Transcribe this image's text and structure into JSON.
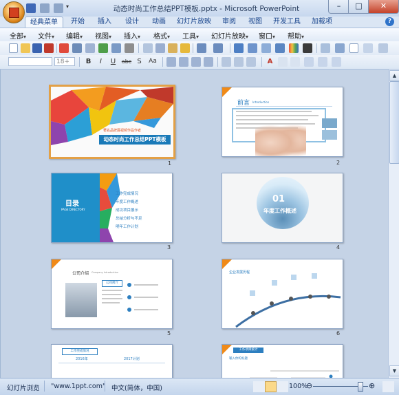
{
  "window": {
    "title": "动态时尚工作总结PPT模板.pptx - Microsoft PowerPoint",
    "minimize_glyph": "–",
    "maximize_glyph": "□",
    "close_glyph": "✕"
  },
  "tabs": [
    "经典菜单",
    "开始",
    "插入",
    "设计",
    "动画",
    "幻灯片放映",
    "审阅",
    "视图",
    "开发工具",
    "加载项"
  ],
  "active_tab": "经典菜单",
  "help_glyph": "?",
  "menu": [
    "全部",
    "文件",
    "编辑",
    "视图",
    "插入",
    "格式",
    "工具",
    "幻灯片放映",
    "窗口",
    "帮助"
  ],
  "menu_arrow": "▾",
  "toolbar": {
    "font_size_value": "18+",
    "bold": "B",
    "italic": "I",
    "underline": "U",
    "strike": "abc",
    "shadow": "S",
    "char_spacing": "Aa",
    "font_color": "A"
  },
  "slides": [
    {
      "number": "1",
      "title": "动态时尚工作总结PPT模板",
      "subtitle": "著名品牌展视频作品作者"
    },
    {
      "number": "2",
      "title": "前言",
      "subtitle": "Introduction"
    },
    {
      "number": "3",
      "title": "目录",
      "subtitle": "PAGE DIRECTORY",
      "items": [
        "工作完成情况",
        "年度工作概述",
        "成功项目展示",
        "总结分析与不足",
        "明年工作计划"
      ]
    },
    {
      "number": "4",
      "title": "01",
      "subtitle": "年度工作概述"
    },
    {
      "number": "5",
      "title": "公司介绍",
      "subtitle": "Company Introduction",
      "box_label": "公司简介"
    },
    {
      "number": "6",
      "title": "企业发展历程",
      "subtitle": ""
    },
    {
      "number": "7",
      "title": "工作完成情况",
      "tags": [
        "2016年",
        "2017计划"
      ]
    },
    {
      "number": "8",
      "title": "工作项目统计",
      "subtitle": "输入你的标题"
    }
  ],
  "statusbar": {
    "view_label": "幻灯片浏览",
    "site": "\"www.1ppt.com\"",
    "language": "中文(简体，中国)",
    "zoom": "100%",
    "zoom_out": "⊖",
    "zoom_in": "⊕"
  },
  "colors": {
    "accent_orange": "#f08a18",
    "accent_blue": "#2d7fc0",
    "selection": "#e3a046"
  }
}
